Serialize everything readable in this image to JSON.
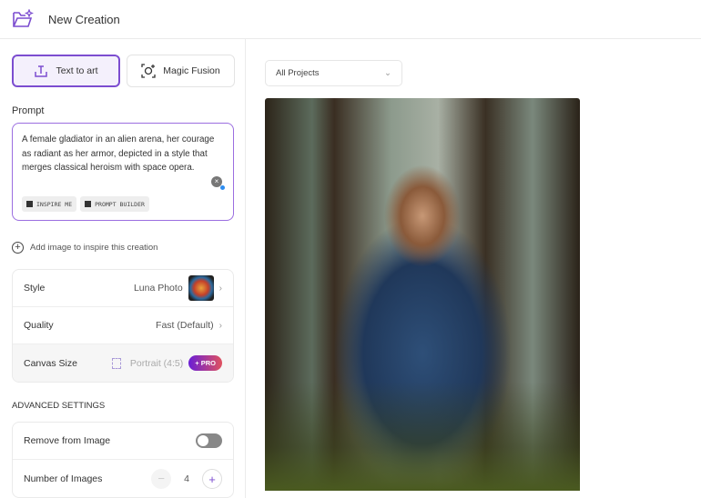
{
  "header": {
    "title": "New Creation",
    "icon": "folder-sparkle-icon"
  },
  "modes": [
    {
      "label": "Text to art",
      "icon": "text-upload-icon",
      "active": true
    },
    {
      "label": "Magic Fusion",
      "icon": "face-scan-icon",
      "active": false
    }
  ],
  "prompt": {
    "label": "Prompt",
    "value": "A female gladiator in an alien arena, her courage as radiant as her armor, depicted in a style that merges classical heroism with space opera.",
    "chips": [
      "INSPIRE ME",
      "PROMPT BUILDER"
    ]
  },
  "add_image": "Add image to inspire this creation",
  "settings": {
    "style": {
      "label": "Style",
      "value": "Luna Photo"
    },
    "quality": {
      "label": "Quality",
      "value": "Fast (Default)"
    },
    "canvas": {
      "label": "Canvas Size",
      "value": "Portrait (4:5)",
      "badge": "+ PRO"
    }
  },
  "advanced": {
    "title": "ADVANCED SETTINGS",
    "remove": {
      "label": "Remove from Image",
      "enabled": false
    },
    "count": {
      "label": "Number of Images",
      "value": "4"
    }
  },
  "projects": {
    "selected": "All Projects"
  },
  "colors": {
    "accent": "#7c4dd0",
    "pro_start": "#6a1fd6",
    "pro_end": "#e0525f"
  }
}
